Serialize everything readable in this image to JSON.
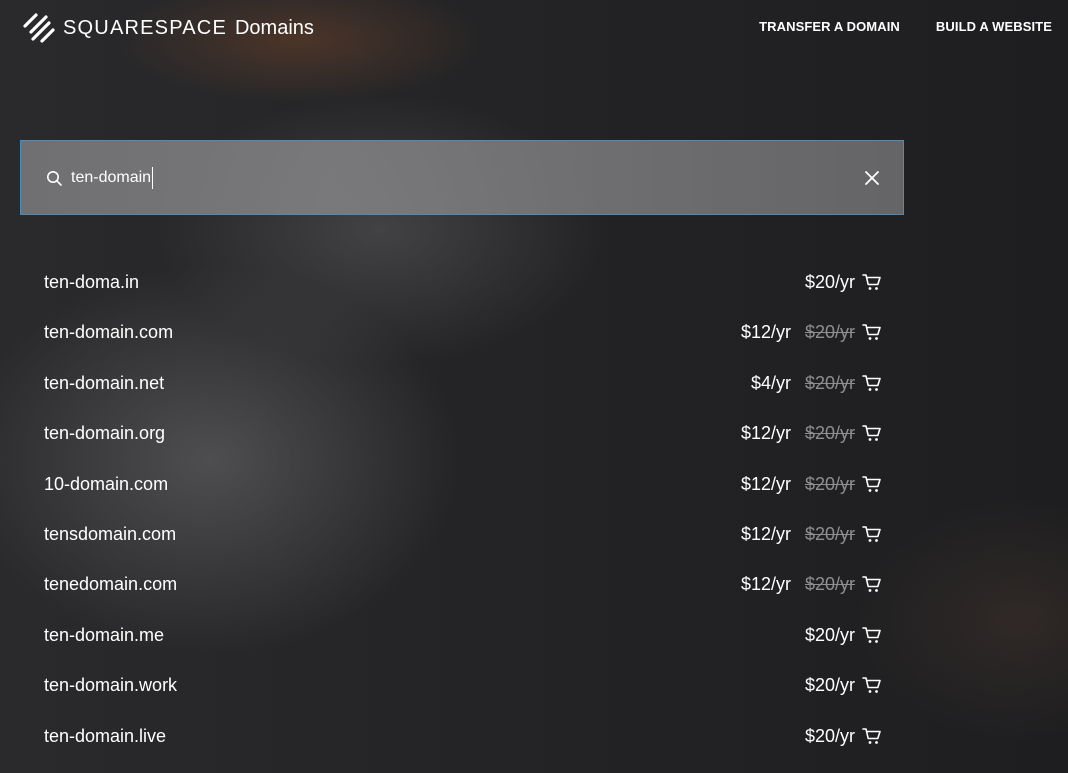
{
  "header": {
    "brand_name": "SQUARESPACE",
    "brand_sub": "Domains",
    "nav": [
      {
        "label": "TRANSFER A DOMAIN"
      },
      {
        "label": "BUILD A WEBSITE"
      }
    ]
  },
  "search": {
    "value": "ten-domain",
    "icon": "search-icon",
    "clear_icon": "close-icon"
  },
  "results": [
    {
      "domain": "ten-doma.in",
      "price": "$20/yr",
      "old_price": ""
    },
    {
      "domain": "ten-domain.com",
      "price": "$12/yr",
      "old_price": "$20/yr"
    },
    {
      "domain": "ten-domain.net",
      "price": "$4/yr",
      "old_price": "$20/yr"
    },
    {
      "domain": "ten-domain.org",
      "price": "$12/yr",
      "old_price": "$20/yr"
    },
    {
      "domain": "10-domain.com",
      "price": "$12/yr",
      "old_price": "$20/yr"
    },
    {
      "domain": "tensdomain.com",
      "price": "$12/yr",
      "old_price": "$20/yr"
    },
    {
      "domain": "tenedomain.com",
      "price": "$12/yr",
      "old_price": "$20/yr"
    },
    {
      "domain": "ten-domain.me",
      "price": "$20/yr",
      "old_price": ""
    },
    {
      "domain": "ten-domain.work",
      "price": "$20/yr",
      "old_price": ""
    },
    {
      "domain": "ten-domain.live",
      "price": "$20/yr",
      "old_price": ""
    }
  ],
  "colors": {
    "background": "#242426",
    "search_border": "#4a8dbd",
    "strike_price": "#8e8e90",
    "text": "#ffffff"
  }
}
